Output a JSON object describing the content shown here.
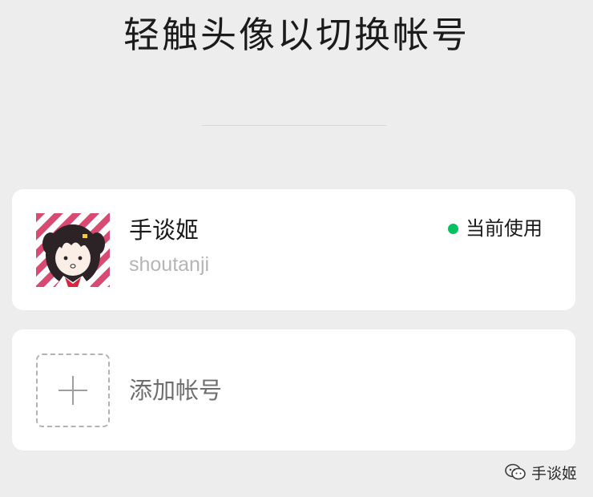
{
  "header": {
    "title": "轻触头像以切换帐号"
  },
  "accounts": [
    {
      "name": "手谈姬",
      "id": "shoutanji",
      "status": "当前使用",
      "status_color": "#07c160",
      "avatar_icon": "anime-avatar"
    }
  ],
  "add_account": {
    "label": "添加帐号",
    "icon": "plus-icon"
  },
  "watermark": {
    "text": "手谈姬",
    "icon": "wechat-icon"
  },
  "colors": {
    "background": "#ededed",
    "card": "#ffffff",
    "status_green": "#07c160"
  }
}
